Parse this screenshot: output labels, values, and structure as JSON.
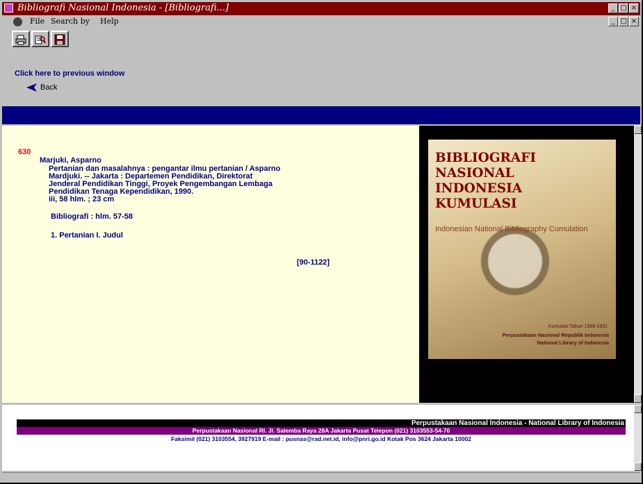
{
  "window": {
    "title": "Bibliografi Nasional Indonesia - [Bibliografi...]",
    "controls": {
      "minimize": "_",
      "maximize": "□",
      "close": "×"
    }
  },
  "menu": {
    "items": [
      "File",
      "Search by",
      "Help"
    ]
  },
  "toolbar": {
    "buttons": [
      "print-icon",
      "search-icon",
      "save-icon"
    ]
  },
  "nav": {
    "prev_text": "Click here to previous window",
    "back_label": "Back"
  },
  "record": {
    "number": "630",
    "author": "Marjuki, Asparno",
    "title_line1": "Pertanian dan masalahnya : pengantar ilmu pertanian  /  Asparno",
    "title_line2": "Mardjuki.  --  Jakarta  :  Departemen Pendidikan, Direktorat",
    "title_line3": "Jenderal Pendidikan Tinggi, Proyek Pengembangan Lembaga",
    "title_line4": "Pendidikan Tenaga Kependidikan,  1990.",
    "collation": "iii, 58 hlm. ; 23 cm",
    "notes": "Bibliografi : hlm. 57-58",
    "subjects": "1.  Pertanian   I.  Judul",
    "control_no": "[90-1122]"
  },
  "cover": {
    "title_lines": [
      "BIBLIOGRAFI",
      "NASIONAL",
      "INDONESIA",
      "KUMULASI"
    ],
    "subtitle": "Indonesian National Bibliography Cumulation",
    "period": "Kumulasi Tahun 1988-1991",
    "publisher1": "Perpustakaan Nasional Republik Indonesia",
    "publisher2": "National Library of Indonesia"
  },
  "footer": {
    "line1": "Perpustakaan Nasional Indonesia - National Library of Indonesia",
    "line2": "Perpustakaan Nasional RI. Jl. Salemba Raya 28A Jakarta Pusat Telepon (021) 3103553-54-70",
    "line3": "Faksimil (021) 3103554, 3927919 E-mail : pusnas@rad.net.id, info@pnri.go.id Kotak Pos 3624 Jakarta 10002"
  },
  "colors": {
    "titlebar": "#800000",
    "bluebar": "#000080",
    "record_bg": "#ffffe0",
    "record_text": "#000080",
    "record_number": "#ff0000"
  }
}
